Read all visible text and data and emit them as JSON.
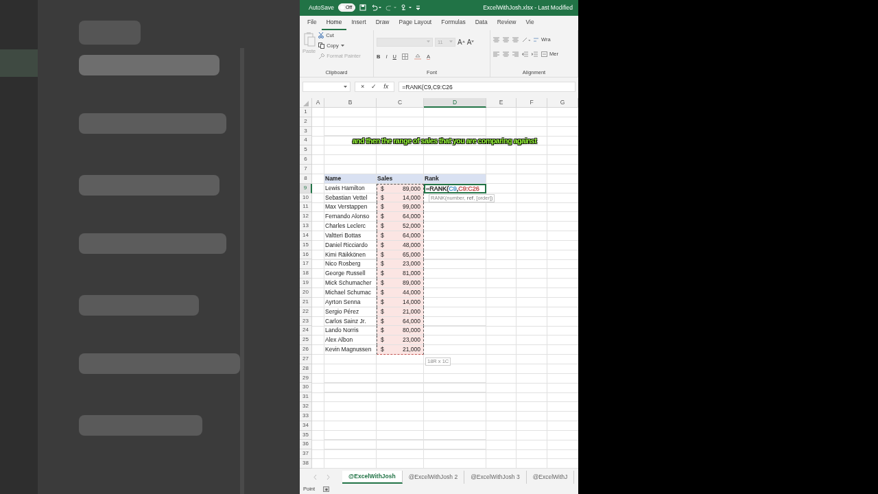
{
  "title_bar": {
    "autosave_label": "AutoSave",
    "autosave_on": false,
    "autosave_state": "Off",
    "file_title": "ExcelWithJosh.xlsx - Last Modified"
  },
  "ribbon_tabs": [
    {
      "label": "File",
      "selected": false
    },
    {
      "label": "Home",
      "selected": true
    },
    {
      "label": "Insert",
      "selected": false
    },
    {
      "label": "Draw",
      "selected": false
    },
    {
      "label": "Page Layout",
      "selected": false
    },
    {
      "label": "Formulas",
      "selected": false
    },
    {
      "label": "Data",
      "selected": false
    },
    {
      "label": "Review",
      "selected": false
    },
    {
      "label": "Vie",
      "selected": false
    }
  ],
  "clipboard": {
    "paste": "Paste",
    "cut": "Cut",
    "copy": "Copy",
    "format_painter": "Format Painter",
    "group_label": "Clipboard"
  },
  "font": {
    "size": "11",
    "grow": "A",
    "shrink": "A",
    "bold": "B",
    "italic": "I",
    "underline": "U",
    "font_color_label": "A",
    "group_label": "Font"
  },
  "alignment": {
    "wrap": "Wra",
    "merge": "Mer",
    "group_label": "Alignment"
  },
  "formula_bar": {
    "cancel": "×",
    "enter": "✓",
    "function": "fx",
    "formula": "=RANK(C9,C9:C26"
  },
  "columns": [
    {
      "label": "A",
      "selected": false
    },
    {
      "label": "B",
      "selected": false
    },
    {
      "label": "C",
      "selected": false
    },
    {
      "label": "D",
      "selected": true
    },
    {
      "label": "E",
      "selected": false
    },
    {
      "label": "F",
      "selected": false
    },
    {
      "label": "G",
      "selected": false
    }
  ],
  "rows": [
    {
      "number": "1",
      "selected": false,
      "kind": "empty"
    },
    {
      "number": "2",
      "selected": false,
      "kind": "empty"
    },
    {
      "number": "3",
      "selected": false,
      "kind": "empty"
    },
    {
      "number": "4",
      "selected": false,
      "kind": "empty"
    },
    {
      "number": "5",
      "selected": false,
      "kind": "empty"
    },
    {
      "number": "6",
      "selected": false,
      "kind": "empty"
    },
    {
      "number": "7",
      "selected": false,
      "kind": "empty"
    },
    {
      "number": "8",
      "selected": false,
      "kind": "header",
      "name": "Name",
      "sales": "Sales",
      "rank": "Rank"
    },
    {
      "number": "9",
      "selected": true,
      "kind": "data",
      "name": "Lewis Hamilton",
      "currency": "$",
      "amount": "89,000",
      "in_range": true,
      "formula_parts": [
        {
          "text": "=RANK(",
          "kind": "text"
        },
        {
          "text": "C9",
          "kind": "reference",
          "color": "#4a90c8"
        },
        {
          "text": ",",
          "kind": "text"
        },
        {
          "text": "C9:C26",
          "kind": "reference",
          "color": "#c0504d"
        }
      ]
    },
    {
      "number": "10",
      "selected": false,
      "kind": "data",
      "name": "Sebastian Vettel",
      "currency": "$",
      "amount": "14,000",
      "in_range": true
    },
    {
      "number": "11",
      "selected": false,
      "kind": "data",
      "name": "Max Verstappen",
      "currency": "$",
      "amount": "99,000",
      "in_range": true
    },
    {
      "number": "12",
      "selected": false,
      "kind": "data",
      "name": "Fernando Alonso",
      "currency": "$",
      "amount": "64,000",
      "in_range": true
    },
    {
      "number": "13",
      "selected": false,
      "kind": "data",
      "name": "Charles Leclerc",
      "currency": "$",
      "amount": "52,000",
      "in_range": true
    },
    {
      "number": "14",
      "selected": false,
      "kind": "data",
      "name": "Valtteri Bottas",
      "currency": "$",
      "amount": "64,000",
      "in_range": true
    },
    {
      "number": "15",
      "selected": false,
      "kind": "data",
      "name": "Daniel Ricciardo",
      "currency": "$",
      "amount": "48,000",
      "in_range": true
    },
    {
      "number": "16",
      "selected": false,
      "kind": "data",
      "name": "Kimi Räikkönen",
      "currency": "$",
      "amount": "65,000",
      "in_range": true
    },
    {
      "number": "17",
      "selected": false,
      "kind": "data",
      "name": "Nico Rosberg",
      "currency": "$",
      "amount": "23,000",
      "in_range": true
    },
    {
      "number": "18",
      "selected": false,
      "kind": "data",
      "name": "George Russell",
      "currency": "$",
      "amount": "81,000",
      "in_range": true
    },
    {
      "number": "19",
      "selected": false,
      "kind": "data",
      "name": "Mick Schumacher",
      "currency": "$",
      "amount": "89,000",
      "in_range": true
    },
    {
      "number": "20",
      "selected": false,
      "kind": "data",
      "name": "Michael Schumac",
      "currency": "$",
      "amount": "44,000",
      "in_range": true
    },
    {
      "number": "21",
      "selected": false,
      "kind": "data",
      "name": "Ayrton Senna",
      "currency": "$",
      "amount": "14,000",
      "in_range": true
    },
    {
      "number": "22",
      "selected": false,
      "kind": "data",
      "name": "Sergio Pérez",
      "currency": "$",
      "amount": "21,000",
      "in_range": true
    },
    {
      "number": "23",
      "selected": false,
      "kind": "data",
      "name": "Carlos Sainz Jr.",
      "currency": "$",
      "amount": "64,000",
      "in_range": true
    },
    {
      "number": "24",
      "selected": false,
      "kind": "data",
      "name": "Lando Norris",
      "currency": "$",
      "amount": "80,000",
      "in_range": true
    },
    {
      "number": "25",
      "selected": false,
      "kind": "data",
      "name": "Alex Albon",
      "currency": "$",
      "amount": "23,000",
      "in_range": true
    },
    {
      "number": "26",
      "selected": false,
      "kind": "data",
      "name": "Kevin Magnussen",
      "currency": "$",
      "amount": "21,000",
      "in_range": true
    },
    {
      "number": "27",
      "selected": false,
      "kind": "empty"
    },
    {
      "number": "28",
      "selected": false,
      "kind": "empty"
    },
    {
      "number": "29",
      "selected": false,
      "kind": "empty"
    },
    {
      "number": "30",
      "selected": false,
      "kind": "empty"
    },
    {
      "number": "31",
      "selected": false,
      "kind": "empty"
    },
    {
      "number": "32",
      "selected": false,
      "kind": "empty"
    },
    {
      "number": "33",
      "selected": false,
      "kind": "empty"
    },
    {
      "number": "34",
      "selected": false,
      "kind": "empty"
    },
    {
      "number": "35",
      "selected": false,
      "kind": "empty"
    },
    {
      "number": "36",
      "selected": false,
      "kind": "empty"
    },
    {
      "number": "37",
      "selected": false,
      "kind": "empty"
    },
    {
      "number": "38",
      "selected": false,
      "kind": "empty"
    }
  ],
  "function_tooltip": "RANK(number, **ref**, [order])",
  "range_size_tip": "18R x 1C",
  "caption": "and then the range of sales that you are comparing against",
  "sheet_tabs": [
    {
      "label": "@ExcelWithJosh",
      "selected": true
    },
    {
      "label": "@ExcelWithJosh 2",
      "selected": false
    },
    {
      "label": "@ExcelWithJosh 3",
      "selected": false
    },
    {
      "label": "@ExcelWithJ",
      "selected": false
    }
  ],
  "status_bar": {
    "mode": "Point"
  }
}
